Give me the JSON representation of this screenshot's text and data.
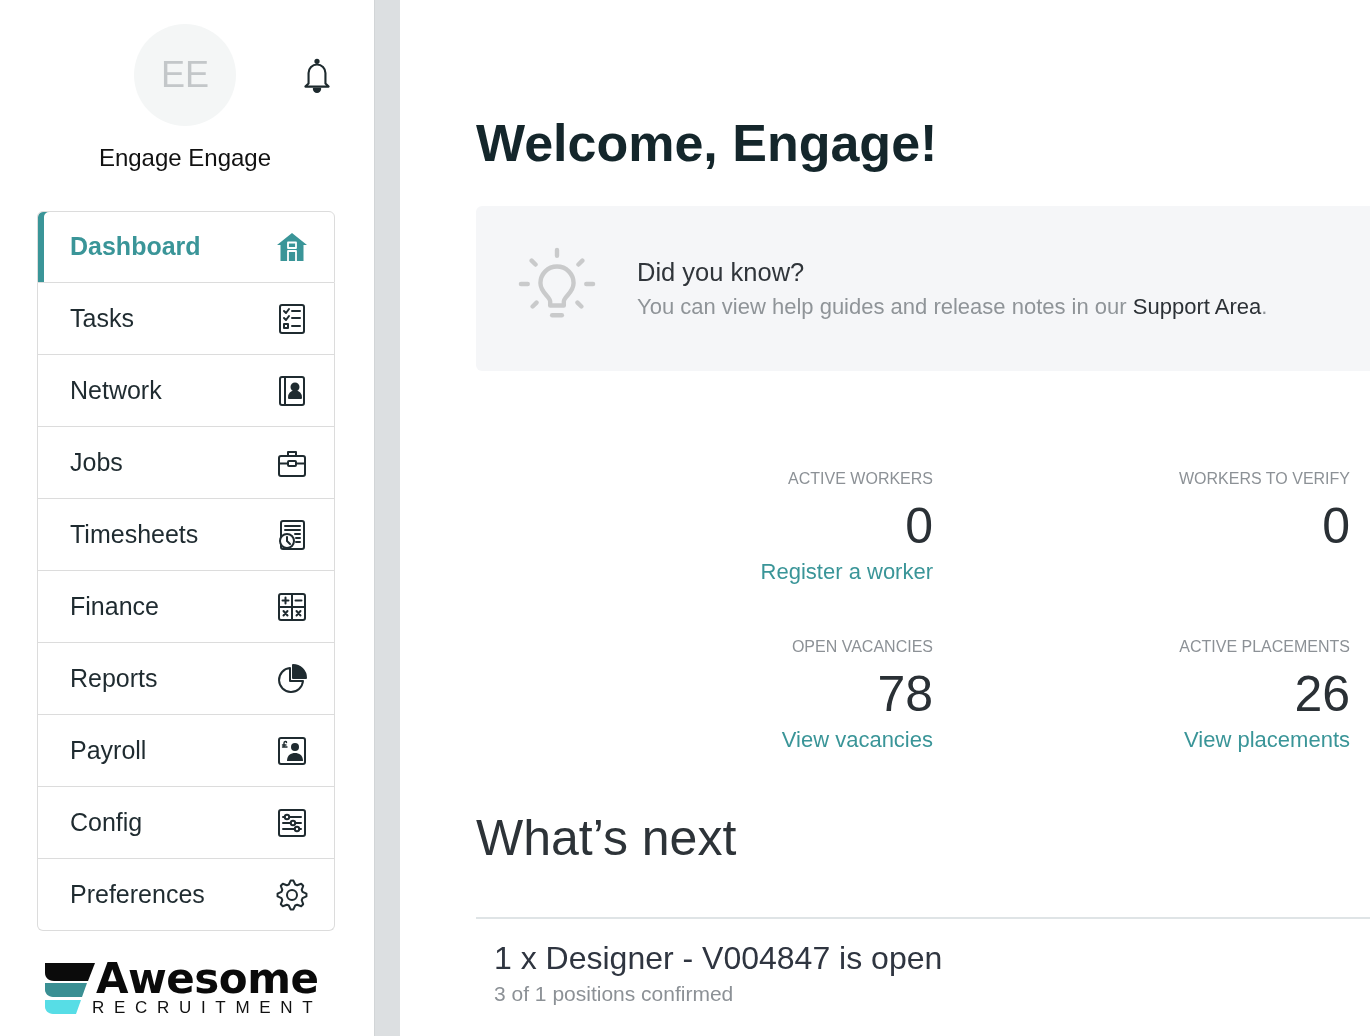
{
  "user": {
    "initials": "EE",
    "name": "Engage Engage"
  },
  "nav": {
    "items": [
      {
        "label": "Dashboard",
        "kind": "home",
        "selected": true
      },
      {
        "label": "Tasks",
        "kind": "checklist",
        "selected": false
      },
      {
        "label": "Network",
        "kind": "contact",
        "selected": false
      },
      {
        "label": "Jobs",
        "kind": "briefcase",
        "selected": false
      },
      {
        "label": "Timesheets",
        "kind": "timesheet",
        "selected": false
      },
      {
        "label": "Finance",
        "kind": "calculator",
        "selected": false
      },
      {
        "label": "Reports",
        "kind": "pie",
        "selected": false
      },
      {
        "label": "Payroll",
        "kind": "payroll",
        "selected": false
      },
      {
        "label": "Config",
        "kind": "sliders",
        "selected": false
      },
      {
        "label": "Preferences",
        "kind": "gear",
        "selected": false
      }
    ]
  },
  "logo": {
    "wordmark": "Awesome",
    "tagline": "RECRUITMENT"
  },
  "main": {
    "title": "Welcome, Engage!",
    "tip": {
      "title": "Did you know?",
      "text_before": "You can view help guides and release notes in our ",
      "link": "Support Area",
      "text_after": "."
    },
    "stats": [
      {
        "label": "ACTIVE WORKERS",
        "value": "0",
        "link": "Register a worker"
      },
      {
        "label": "WORKERS TO VERIFY",
        "value": "0"
      },
      {
        "label": "OPEN VACANCIES",
        "value": "78",
        "link": "View vacancies"
      },
      {
        "label": "ACTIVE PLACEMENTS",
        "value": "26",
        "link": "View placements"
      }
    ],
    "whats_next": {
      "title": "What’s next",
      "items": [
        {
          "title": "1 x Designer - V004847 is open",
          "subtitle": "3 of 1 positions confirmed"
        }
      ]
    }
  }
}
